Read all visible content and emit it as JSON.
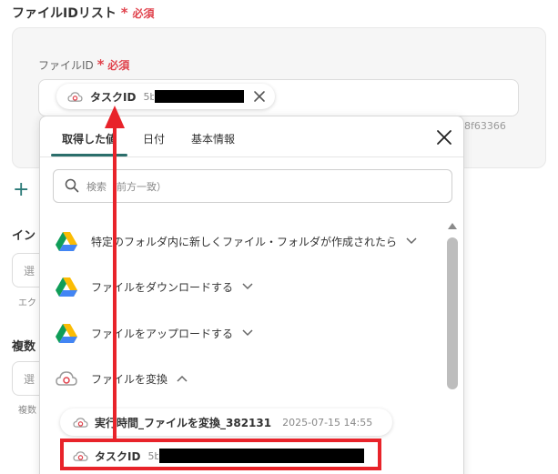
{
  "section": {
    "title": "ファイルIDリスト",
    "required_star": "*",
    "required_text": "必須"
  },
  "field": {
    "label": "ファイルID",
    "required_star": "*",
    "required_text": "必須",
    "chip_label": "タスクID",
    "chip_value_prefix": "5b"
  },
  "background_hash_text": "8f63366",
  "side": {
    "label_1": "イン",
    "input_1_placeholder": "選",
    "help_1": "エク",
    "label_2": "複数",
    "input_2_placeholder": "選",
    "help_2": "複数"
  },
  "dropdown": {
    "tabs": [
      {
        "label": "取得した値",
        "active": true
      },
      {
        "label": "日付",
        "active": false
      },
      {
        "label": "基本情報",
        "active": false
      }
    ],
    "search_placeholder": "検索（前方一致）",
    "items": [
      {
        "label": "特定のフォルダ内に新しくファイル・フォルダが作成されたら",
        "icon": "google-drive-icon",
        "chevron": "down"
      },
      {
        "label": "ファイルをダウンロードする",
        "icon": "google-drive-icon",
        "chevron": "down"
      },
      {
        "label": "ファイルをアップロードする",
        "icon": "google-drive-icon",
        "chevron": "down"
      },
      {
        "label": "ファイルを変換",
        "icon": "cloud-convert-icon",
        "chevron": "up"
      }
    ],
    "sub_items": [
      {
        "name": "実行時間_ファイルを変換_382131",
        "timestamp": "2025-07-15 14:55"
      },
      {
        "name": "タスクID",
        "value_prefix": "5b"
      }
    ]
  },
  "colors": {
    "accent": "#2b6e6b",
    "required": "#e0434d",
    "highlight": "#e8232a"
  }
}
